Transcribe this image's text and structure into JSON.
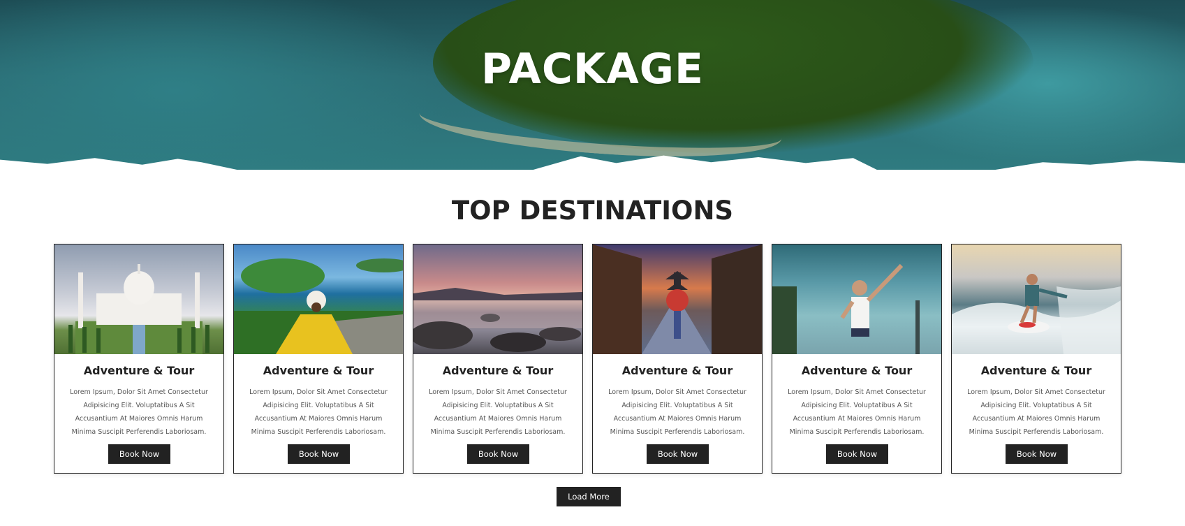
{
  "hero": {
    "title": "PACKAGE"
  },
  "section": {
    "title": "TOP DESTINATIONS"
  },
  "cards": [
    {
      "title": "Adventure & Tour",
      "description": "Lorem Ipsum, Dolor Sit Amet Consectetur Adipisicing Elit. Voluptatibus A Sit Accusantium At Maiores Omnis Harum Minima Suscipit Perferendis Laboriosam.",
      "button": "Book Now",
      "image": "taj-mahal-photo"
    },
    {
      "title": "Adventure & Tour",
      "description": "Lorem Ipsum, Dolor Sit Amet Consectetur Adipisicing Elit. Voluptatibus A Sit Accusantium At Maiores Omnis Harum Minima Suscipit Perferendis Laboriosam.",
      "button": "Book Now",
      "image": "island-woman-yellow-dress-photo"
    },
    {
      "title": "Adventure & Tour",
      "description": "Lorem Ipsum, Dolor Sit Amet Consectetur Adipisicing Elit. Voluptatibus A Sit Accusantium At Maiores Omnis Harum Minima Suscipit Perferendis Laboriosam.",
      "button": "Book Now",
      "image": "rocky-shore-sunset-photo"
    },
    {
      "title": "Adventure & Tour",
      "description": "Lorem Ipsum, Dolor Sit Amet Consectetur Adipisicing Elit. Voluptatibus A Sit Accusantium At Maiores Omnis Harum Minima Suscipit Perferendis Laboriosam.",
      "button": "Book Now",
      "image": "japanese-street-pagoda-photo"
    },
    {
      "title": "Adventure & Tour",
      "description": "Lorem Ipsum, Dolor Sit Amet Consectetur Adipisicing Elit. Voluptatibus A Sit Accusantium At Maiores Omnis Harum Minima Suscipit Perferendis Laboriosam.",
      "button": "Book Now",
      "image": "man-arms-raised-photo"
    },
    {
      "title": "Adventure & Tour",
      "description": "Lorem Ipsum, Dolor Sit Amet Consectetur Adipisicing Elit. Voluptatibus A Sit Accusantium At Maiores Omnis Harum Minima Suscipit Perferendis Laboriosam.",
      "button": "Book Now",
      "image": "woman-surfing-photo"
    }
  ],
  "load_more": "Load More",
  "colors": {
    "button_bg": "#222222",
    "button_text": "#ffffff",
    "heading": "#222222",
    "body_text": "#555555"
  }
}
